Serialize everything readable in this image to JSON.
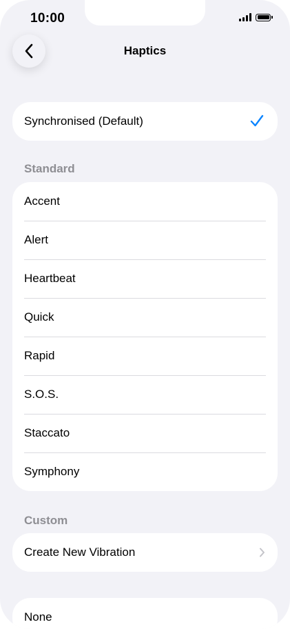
{
  "status_bar": {
    "time": "10:00",
    "icons": [
      "signal-icon",
      "battery-icon"
    ]
  },
  "nav": {
    "title": "Haptics",
    "back_icon": "chevron-left-icon"
  },
  "selected": {
    "label": "Synchronised (Default)",
    "checked": true,
    "check_icon": "checkmark-icon",
    "check_color": "#0a84ff"
  },
  "standard": {
    "header": "Standard",
    "items": [
      {
        "label": "Accent"
      },
      {
        "label": "Alert"
      },
      {
        "label": "Heartbeat"
      },
      {
        "label": "Quick"
      },
      {
        "label": "Rapid"
      },
      {
        "label": "S.O.S."
      },
      {
        "label": "Staccato"
      },
      {
        "label": "Symphony"
      }
    ]
  },
  "custom": {
    "header": "Custom",
    "create_label": "Create New Vibration",
    "chevron_icon": "chevron-right-icon"
  },
  "none_option": {
    "label": "None"
  },
  "colors": {
    "background": "#f2f2f7",
    "card": "#ffffff",
    "section_header": "#8e8e93",
    "separator": "#dadadf",
    "accent": "#0a84ff"
  }
}
